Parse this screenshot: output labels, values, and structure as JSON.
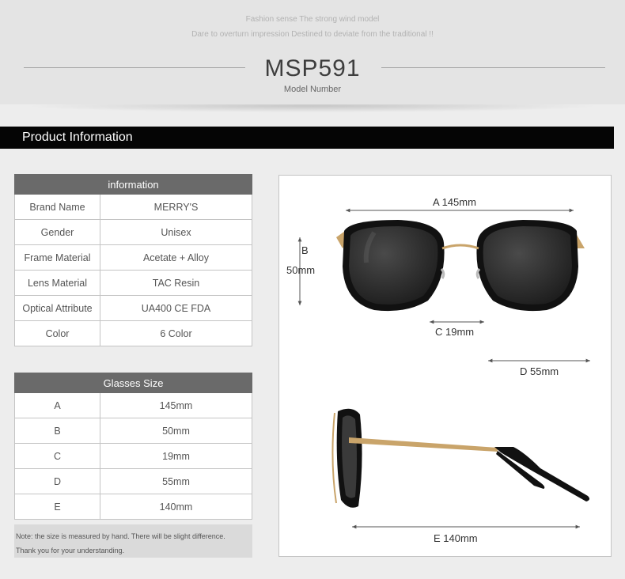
{
  "header": {
    "tagline_1": "Fashion sense The strong wind model",
    "tagline_2": "Dare to overturn impression Destined to deviate from the traditional !!",
    "model_number": "MSP591",
    "model_caption": "Model Number"
  },
  "section_title": "Product Information",
  "info_table": {
    "header": "information",
    "rows": [
      {
        "label": "Brand Name",
        "value": "MERRY'S"
      },
      {
        "label": "Gender",
        "value": "Unisex"
      },
      {
        "label": "Frame Material",
        "value": "Acetate + Alloy"
      },
      {
        "label": "Lens Material",
        "value": "TAC Resin"
      },
      {
        "label": "Optical Attribute",
        "value": "UA400 CE FDA"
      },
      {
        "label": "Color",
        "value": "6 Color"
      }
    ]
  },
  "size_table": {
    "header": "Glasses Size",
    "rows": [
      {
        "label": "A",
        "value": "145mm"
      },
      {
        "label": "B",
        "value": "50mm"
      },
      {
        "label": "C",
        "value": "19mm"
      },
      {
        "label": "D",
        "value": "55mm"
      },
      {
        "label": "E",
        "value": "140mm"
      }
    ]
  },
  "note": {
    "line_1": "Note: the size is measured by hand. There will be slight difference.",
    "line_2": "Thank you for your understanding."
  },
  "diagram": {
    "dim_a": "A 145mm",
    "dim_b_letter": "B",
    "dim_b_value": "50mm",
    "dim_c": "C 19mm",
    "dim_d": "D 55mm",
    "dim_e": "E 140mm"
  },
  "colors": {
    "header_bar": "#050505",
    "table_header": "#6a6a6a",
    "frame": "#111111",
    "lens": "#2e2e2e",
    "metal": "#c9a46a"
  }
}
